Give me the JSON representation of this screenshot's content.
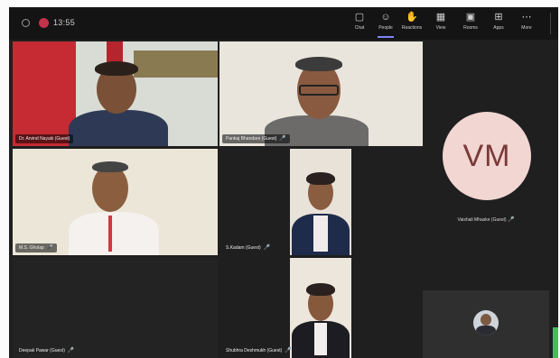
{
  "toolbar": {
    "timer": "13:55",
    "buttons": [
      {
        "name": "chat",
        "label": "Chat",
        "icon": "chat-icon"
      },
      {
        "name": "people",
        "label": "People",
        "icon": "people-icon"
      },
      {
        "name": "reactions",
        "label": "Reactions",
        "icon": "reactions-icon"
      },
      {
        "name": "view",
        "label": "View",
        "icon": "view-icon"
      },
      {
        "name": "rooms",
        "label": "Rooms",
        "icon": "rooms-icon"
      },
      {
        "name": "apps",
        "label": "Apps",
        "icon": "apps-icon"
      },
      {
        "name": "more",
        "label": "More",
        "icon": "more-icon"
      }
    ]
  },
  "participants": {
    "tile1": "Dr. Arvind Nayaki (Guest)",
    "tile2": "Pankaj Bhandare (Guest)",
    "tile3": "M.S. Gholap",
    "tile4": "S.Kadam (Guest)",
    "tile5": "Deepak Pawar (Guest)",
    "tile6": "Shubhra Deshmukh (Guest)",
    "tile7": "Vaishali Mhaske (Guest)"
  },
  "side_avatar": {
    "initials": "VM",
    "color": "#f2d6d1"
  }
}
